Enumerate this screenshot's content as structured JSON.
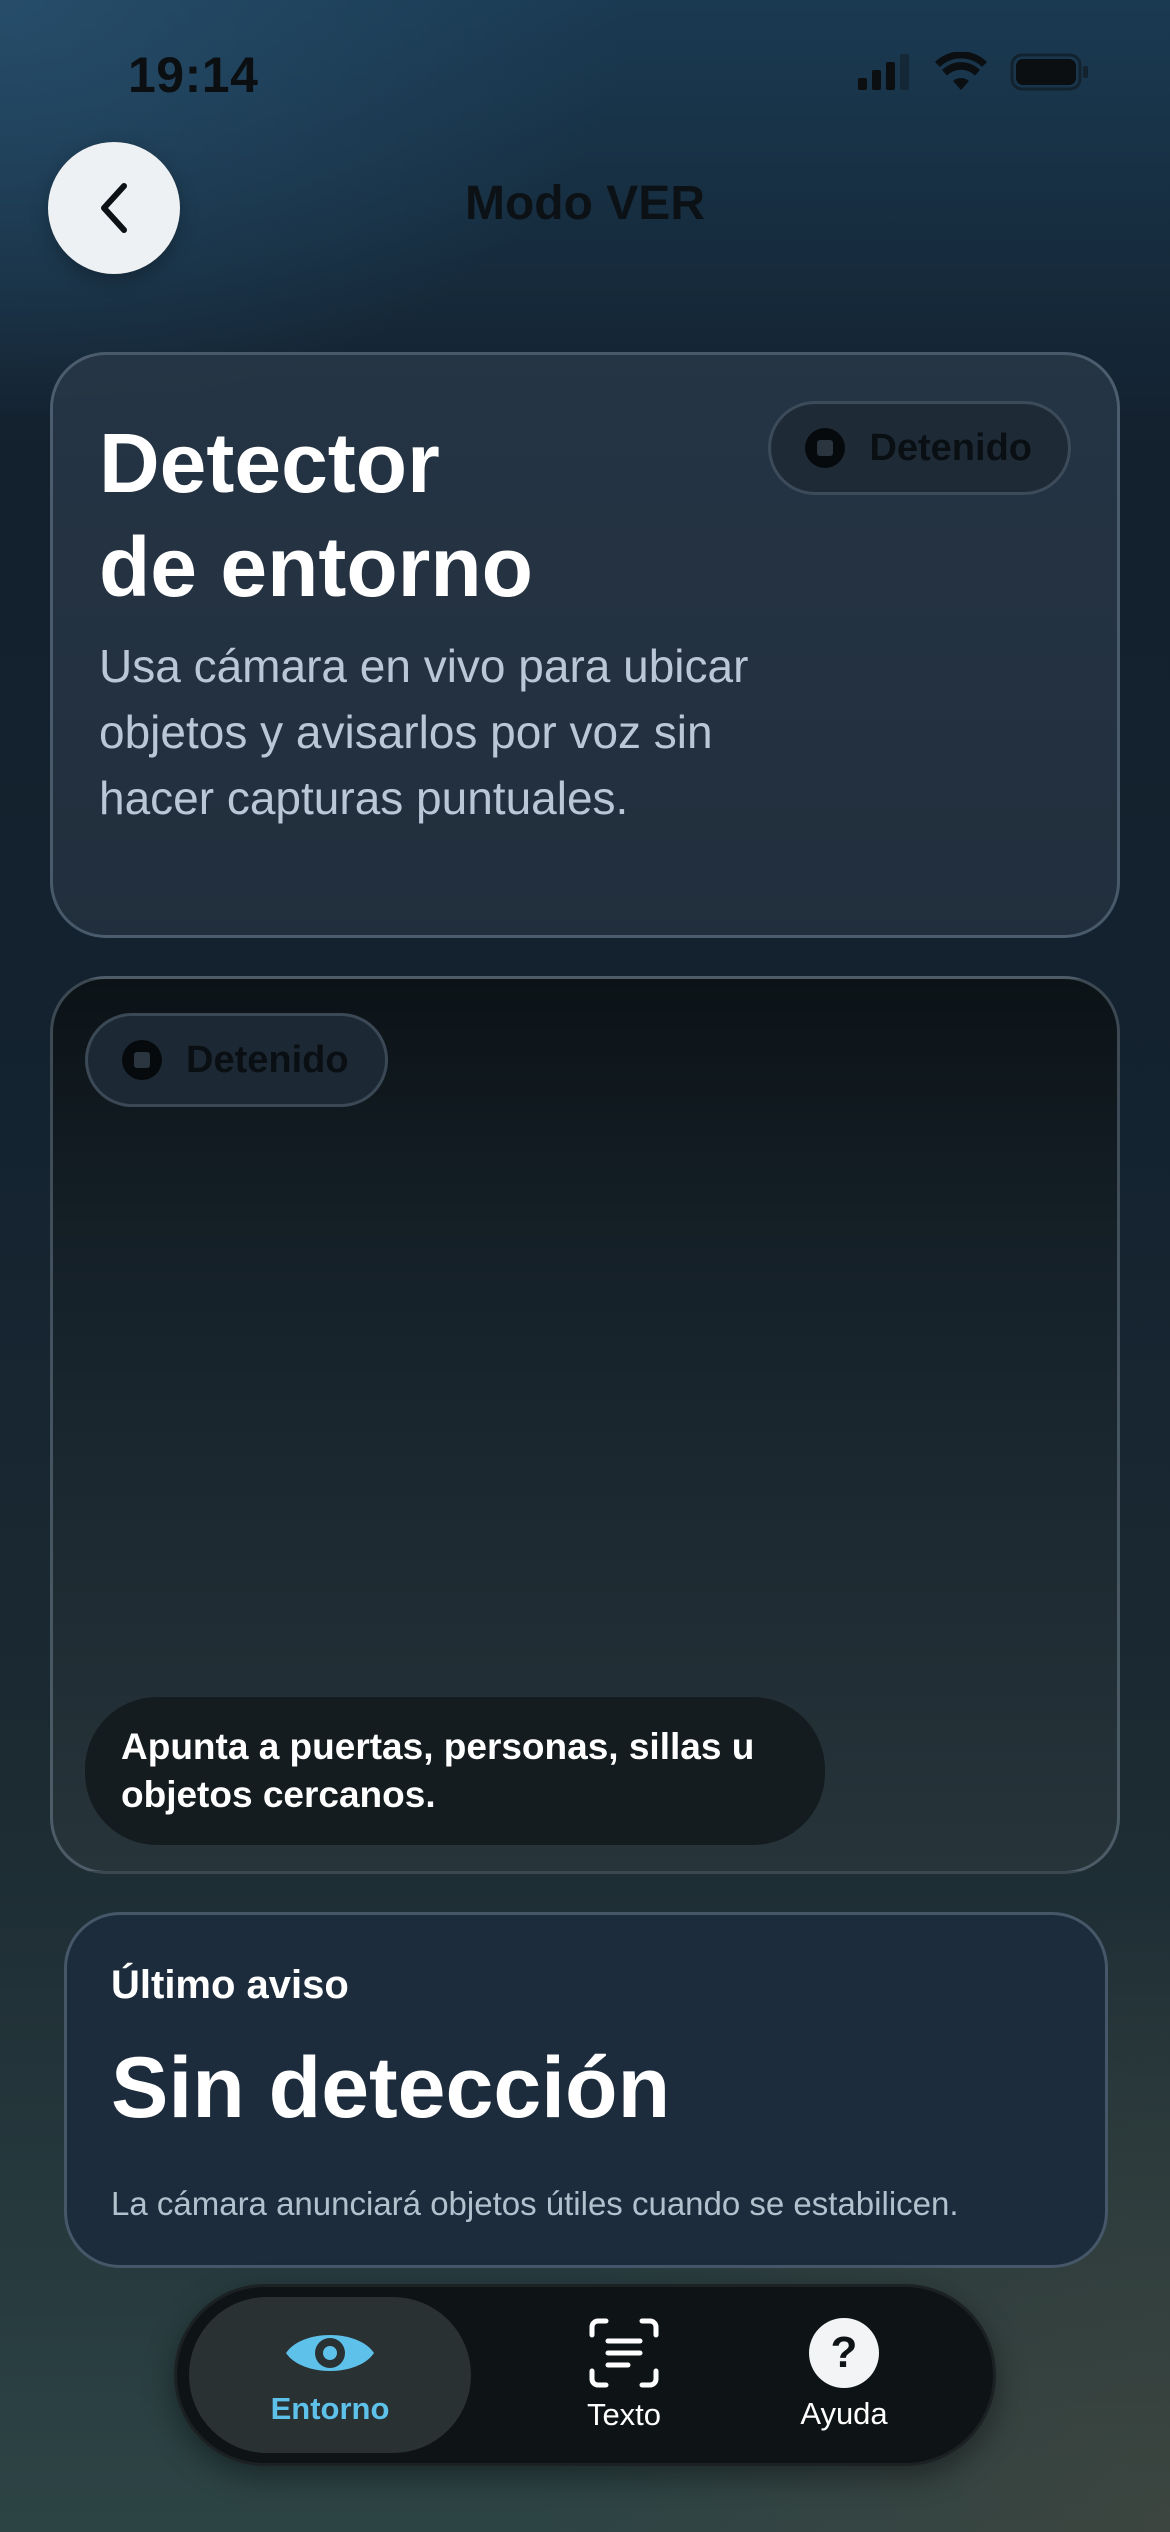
{
  "status_bar": {
    "time": "19:14"
  },
  "nav": {
    "title": "Modo VER",
    "back_icon": "chevron-left-icon"
  },
  "header_card": {
    "title_line1": "Detector",
    "title_line2": "de entorno",
    "description": "Usa cámara en vivo para ubicar objetos y avisarlos por voz sin hacer capturas puntuales.",
    "status_label": "Detenido"
  },
  "camera": {
    "status_label": "Detenido",
    "hint": "Apunta a puertas, personas, sillas u objetos cercanos."
  },
  "last_alert": {
    "eyebrow": "Último aviso",
    "title": "Sin detección",
    "description": "La cámara anunciará objetos útiles cuando se estabilicen."
  },
  "tabs": [
    {
      "label": "Entorno",
      "icon": "eye-icon",
      "active": true
    },
    {
      "label": "Texto",
      "icon": "text-scan-icon",
      "active": false
    },
    {
      "label": "Ayuda",
      "icon": "help-icon",
      "active": false
    }
  ],
  "colors": {
    "accent": "#5ec1ea",
    "card": "#1d2c3c",
    "tab_bar": "#0e1416"
  }
}
